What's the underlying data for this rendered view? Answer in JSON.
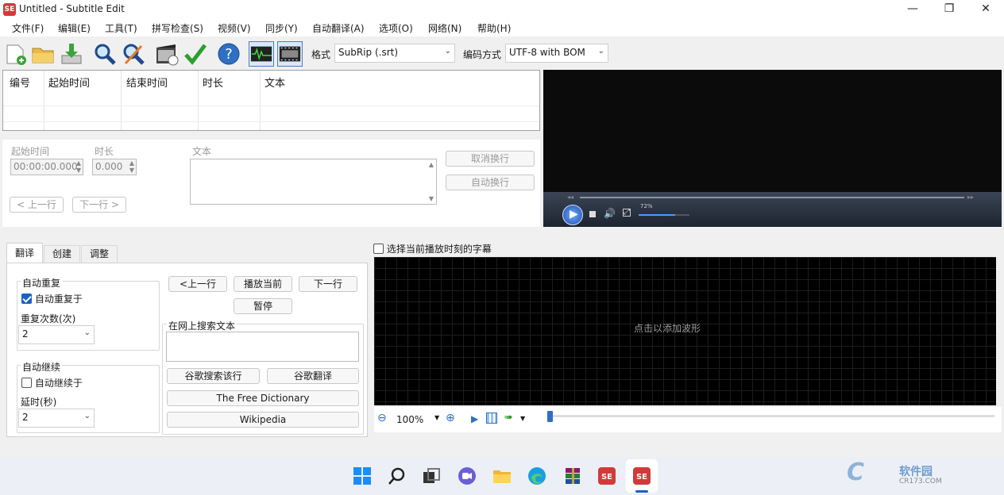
{
  "window": {
    "title": "Untitled - Subtitle Edit",
    "minimize": "—",
    "maximize": "❐",
    "close": "✕"
  },
  "menu": [
    "文件(F)",
    "编辑(E)",
    "工具(T)",
    "拼写检查(S)",
    "视频(V)",
    "同步(Y)",
    "自动翻译(A)",
    "选项(O)",
    "网络(N)",
    "帮助(H)"
  ],
  "toolbar": {
    "format_label": "格式",
    "format_value": "SubRip (.srt)",
    "encoding_label": "编码方式",
    "encoding_value": "UTF-8 with BOM"
  },
  "grid": {
    "columns": [
      "编号",
      "起始时间",
      "结束时间",
      "时长",
      "文本"
    ]
  },
  "editor": {
    "start_label": "起始时间",
    "start_value": "00:00:00.000",
    "duration_label": "时长",
    "duration_value": "0.000",
    "text_label": "文本",
    "unbreak": "取消换行",
    "autobreak": "自动换行",
    "prev": "< 上一行",
    "next": "下一行 >"
  },
  "video": {
    "volume": "72%"
  },
  "tabs": [
    "翻译",
    "创建",
    "调整"
  ],
  "translate": {
    "auto_repeat_group": "自动重复",
    "auto_repeat_on": "自动重复于",
    "repeat_count_label": "重复次数(次)",
    "repeat_count": "2",
    "auto_continue_group": "自动继续",
    "auto_continue_on": "自动继续于",
    "delay_label": "延时(秒)",
    "delay": "2",
    "prev": "<上一行",
    "play_current": "播放当前",
    "next": "下一行",
    "pause": "暂停",
    "search_group": "在网上搜索文本",
    "google_search": "谷歌搜索该行",
    "google_translate": "谷歌翻译",
    "free_dict": "The Free Dictionary",
    "wikipedia": "Wikipedia"
  },
  "waveform": {
    "select_current": "选择当前播放时刻的字幕",
    "hint": "点击以添加波形",
    "zoom": "100%"
  },
  "watermark": {
    "text": "软件园",
    "site": "CR173.COM"
  }
}
